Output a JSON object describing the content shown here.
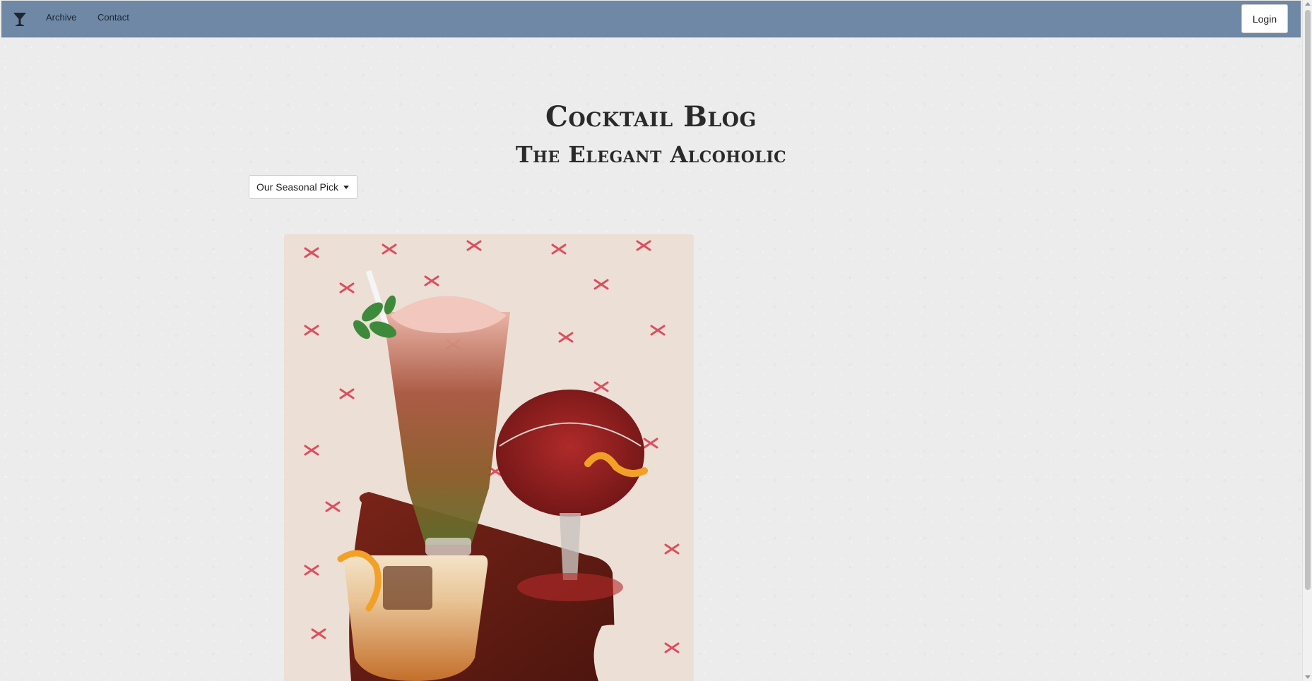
{
  "navbar": {
    "brand_icon": "cocktail-glass-icon",
    "links": [
      {
        "label": "Archive"
      },
      {
        "label": "Contact"
      }
    ],
    "login_label": "Login",
    "background": "#6e88a5"
  },
  "header": {
    "title": "Cocktail Blog",
    "subtitle": "The Elegant Alcoholic"
  },
  "dropdown": {
    "selected": "Our Seasonal Pick",
    "icon": "caret-down-icon"
  },
  "featured_image": {
    "subject": "three cocktails on a wooden board",
    "accent": "#c8273a"
  }
}
